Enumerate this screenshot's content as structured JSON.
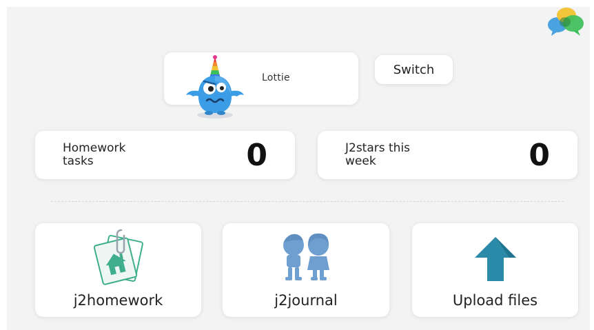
{
  "user": {
    "name": "Lottie",
    "avatar_icon": "blue-monster-avatar-icon",
    "switch_label": "Switch"
  },
  "stats": {
    "homework": {
      "label": "Homework tasks",
      "value": "0"
    },
    "stars": {
      "label": "J2stars this week",
      "value": "0"
    }
  },
  "apps": [
    {
      "label": "j2homework",
      "icon": "homework-tag-icon",
      "color": "#3fae8c"
    },
    {
      "label": "j2journal",
      "icon": "two-people-icon",
      "color": "#6f9fd0"
    },
    {
      "label": "Upload files",
      "icon": "upload-arrow-icon",
      "color": "#2b8aa8"
    }
  ],
  "logo": {
    "icon": "chat-bubbles-logo-icon"
  },
  "colors": {
    "background": "#f3f3f4",
    "card": "#ffffff",
    "homework_green": "#3fae8c",
    "journal_blue": "#6f9fd0",
    "upload_teal": "#2b8aa8",
    "avatar_blue": "#3b9de6"
  }
}
